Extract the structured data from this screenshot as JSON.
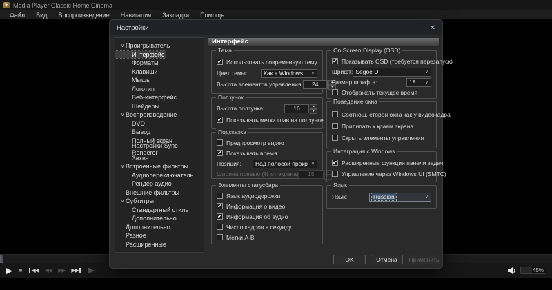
{
  "icons": {
    "chevron_down": "∨",
    "dropdown_arrow": "∨",
    "check": "✔",
    "spin_up": "▴",
    "spin_down": "▾",
    "close": "✕",
    "play": "▶",
    "stop": "■",
    "skip_back_arrows": "◀◀",
    "rewind_arrows": "◀◀",
    "fast_forward_arrows": "▶▶",
    "skip_forward_arrows": "▶▶",
    "step_arrow": "▶"
  },
  "window": {
    "title": "Media Player Classic Home Cinema",
    "menu": [
      "Файл",
      "Вид",
      "Воспроизведение",
      "Навигация",
      "Закладки",
      "Помощь"
    ]
  },
  "dialog": {
    "title": "Настройки",
    "panel_header": "Интерфейс",
    "tree": {
      "items": [
        {
          "label": "Проигрыватель",
          "expandable": true
        },
        {
          "label": "Интерфейс",
          "selected": true
        },
        {
          "label": "Форматы"
        },
        {
          "label": "Клавиши"
        },
        {
          "label": "Мышь"
        },
        {
          "label": "Логотип"
        },
        {
          "label": "Веб-интерфейс"
        },
        {
          "label": "Шейдеры"
        },
        {
          "label": "Воспроизведение",
          "expandable": true
        },
        {
          "label": "DVD"
        },
        {
          "label": "Вывод"
        },
        {
          "label": "Полный экран"
        },
        {
          "label": "Настройки Sync Renderer"
        },
        {
          "label": "Захват"
        },
        {
          "label": "Встроенные фильтры",
          "expandable": true
        },
        {
          "label": "Аудиопереключатель"
        },
        {
          "label": "Рендер аудио"
        },
        {
          "label": "Внешние фильтры"
        },
        {
          "label": "Субтитры",
          "expandable": true
        },
        {
          "label": "Стандартный стиль"
        },
        {
          "label": "Дополнительно"
        },
        {
          "label": "Дополнительно"
        },
        {
          "label": "Разное"
        },
        {
          "label": "Расширенные"
        }
      ]
    },
    "groups": {
      "theme": {
        "label": "Тема",
        "use_modern": {
          "label": "Использовать современную тему",
          "checked": true
        },
        "color_label": "Цвет темы:",
        "color_value": "Как в Windows",
        "controls_height_label": "Высота элементов управления:",
        "controls_height_value": "24"
      },
      "seekbar": {
        "label": "Ползунок",
        "height_label": "Высота ползунка:",
        "height_value": "16",
        "chapter_marks": {
          "label": "Показывать метки глав на ползунке",
          "checked": true
        }
      },
      "tooltip": {
        "label": "Подсказка",
        "video_preview": {
          "label": "Предпросмотр видео",
          "checked": false
        },
        "show_time": {
          "label": "Показывать время",
          "checked": true
        },
        "position_label": "Позиция:",
        "position_value": "Над полосой прокрутки",
        "preview_width_label": "Ширина превью (% от экрана)",
        "preview_width_value": "15"
      },
      "statusbar": {
        "label": "Элементы статусбара",
        "audio_lang": {
          "label": "Язык аудиодорожки",
          "checked": false
        },
        "video_info": {
          "label": "Информация о видео",
          "checked": true
        },
        "audio_info": {
          "label": "Информация об аудио",
          "checked": true
        },
        "fps": {
          "label": "Число кадров в секунду",
          "checked": false
        },
        "ab_marks": {
          "label": "Метки A-B",
          "checked": false
        }
      },
      "osd": {
        "label": "On Screen Display (OSD)",
        "show_osd": {
          "label": "Показывать OSD (требуется перезапуск)",
          "checked": true
        },
        "font_label": "Шрифт:",
        "font_value": "Segoe UI",
        "font_size_label": "Размер шрифта:",
        "font_size_value": "18",
        "show_current_time": {
          "label": "Отображать текущее время",
          "checked": false
        }
      },
      "window_behavior": {
        "label": "Поведение окна",
        "aspect": {
          "label": "Соотнош. сторон окна как у видеокадра",
          "checked": false
        },
        "snap": {
          "label": "Прилипать к краям экрана",
          "checked": false
        },
        "hide_controls": {
          "label": "Скрыть элементы управления",
          "checked": false
        }
      },
      "integration": {
        "label": "Интеграция с Windows",
        "taskbar": {
          "label": "Расширенные функции панели задач",
          "checked": true
        },
        "smtc": {
          "label": "Управление через Windows UI (SMTC)",
          "checked": false
        }
      },
      "language": {
        "label": "Язык",
        "lang_label": "Язык:",
        "lang_value": "Russian"
      }
    },
    "buttons": {
      "ok": "OK",
      "cancel": "Отмена",
      "apply": "Применить"
    }
  },
  "player": {
    "volume": "45%"
  }
}
